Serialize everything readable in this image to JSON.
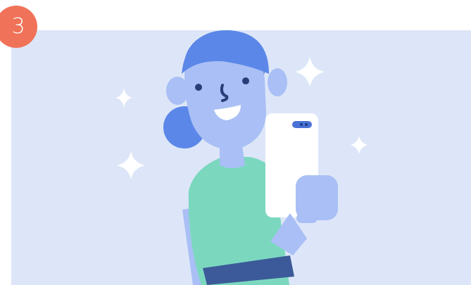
{
  "step": {
    "number": "3",
    "badge_color": "#f07259"
  },
  "illustration": {
    "subject": "woman-taking-selfie",
    "background_color": "#dde6f8",
    "colors": {
      "hair": "#5b87e8",
      "skin": "#a9bff5",
      "shirt": "#7bd8bf",
      "belt": "#3c5a99",
      "phone": "#ffffff",
      "sparkle": "#ffffff",
      "outline": "#2a3d78"
    },
    "icons": [
      "sparkle-icon",
      "phone-icon",
      "camera-icon"
    ]
  }
}
